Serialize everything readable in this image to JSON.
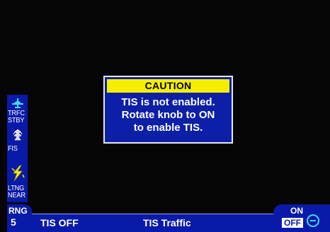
{
  "caution_dialog": {
    "header": "CAUTION",
    "lines": [
      "TIS is not enabled.",
      "Rotate knob to ON",
      "to enable TIS."
    ]
  },
  "side_panel": {
    "items": [
      {
        "icon": "airplane-icon",
        "label_lines": [
          "TRFC",
          "STBY"
        ]
      },
      {
        "icon": "fis-icon",
        "label_lines": [
          "FIS"
        ]
      },
      {
        "icon": "lightning-icon",
        "label_lines": [
          "LTNG",
          "NEAR"
        ]
      }
    ]
  },
  "status_bar": {
    "range_label": "RNG",
    "range_value": "5",
    "tis_status": "TIS OFF",
    "mode_title": "TIS Traffic"
  },
  "knob": {
    "on_label": "ON",
    "off_label": "OFF",
    "icon": "rotate-knob-icon"
  },
  "colors": {
    "panel_blue": "#0a1aa8",
    "caution_yellow": "#f6ee00",
    "icon_cyan": "#3fd8ff",
    "lightning_yellow": "#f6ee00"
  }
}
